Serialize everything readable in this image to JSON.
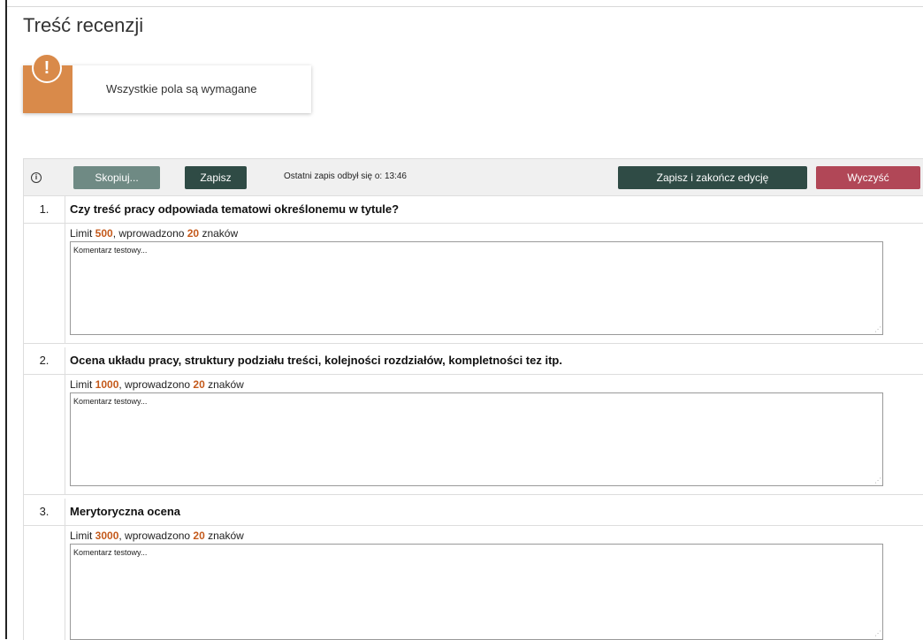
{
  "page": {
    "title": "Treść recenzji"
  },
  "alert": {
    "message": "Wszystkie pola są wymagane"
  },
  "toolbar": {
    "copy_label": "Skopiuj...",
    "save_label": "Zapisz",
    "last_save_text": "Ostatni zapis odbył się o: 13:46",
    "finish_label": "Zapisz i zakończ edycję",
    "clear_label": "Wyczyść"
  },
  "questions": [
    {
      "number": "1.",
      "text": "Czy treść pracy odpowiada tematowi określonemu w tytule?",
      "limit_prefix": "Limit ",
      "limit": "500",
      "entered_prefix": ", wprowadzono ",
      "entered": "20",
      "entered_suffix": " znaków",
      "comment": "Komentarz testowy..."
    },
    {
      "number": "2.",
      "text": "Ocena układu pracy, struktury podziału treści, kolejności rozdziałów, kompletności tez itp.",
      "limit_prefix": "Limit ",
      "limit": "1000",
      "entered_prefix": ", wprowadzono ",
      "entered": "20",
      "entered_suffix": " znaków",
      "comment": "Komentarz testowy..."
    },
    {
      "number": "3.",
      "text": "Merytoryczna ocena",
      "limit_prefix": "Limit ",
      "limit": "3000",
      "entered_prefix": ", wprowadzono ",
      "entered": "20",
      "entered_suffix": " znaków",
      "comment": "Komentarz testowy..."
    }
  ],
  "colors": {
    "accent_orange": "#d98a4a",
    "btn_dark": "#2f4b45",
    "btn_light": "#6f8a84",
    "btn_clear": "#b14757",
    "limit_number": "#c45a1c"
  }
}
